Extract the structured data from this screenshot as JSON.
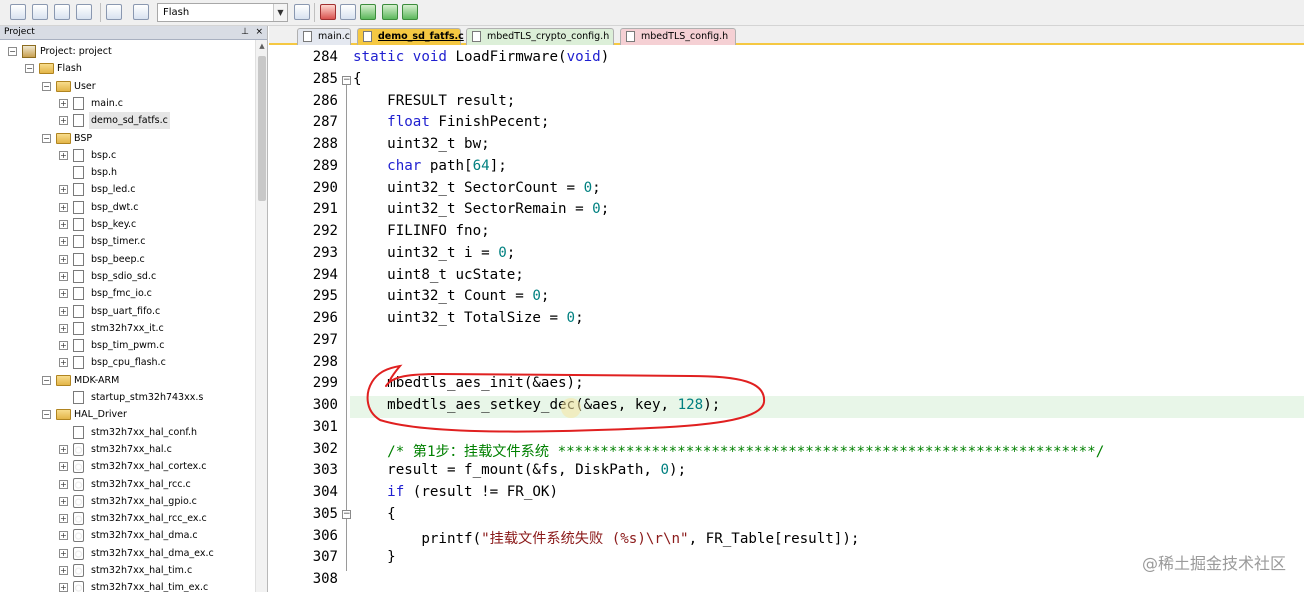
{
  "toolbar": {
    "target": "Flash"
  },
  "project": {
    "title": "Project",
    "pin": "    ",
    "close": "×",
    "root": "Project: project",
    "target": "Flash",
    "groups": [
      {
        "name": "User",
        "files": [
          "main.c",
          "demo_sd_fatfs.c"
        ]
      },
      {
        "name": "BSP",
        "files": [
          "bsp.c",
          "bsp.h",
          "bsp_led.c",
          "bsp_dwt.c",
          "bsp_key.c",
          "bsp_timer.c",
          "bsp_beep.c",
          "bsp_sdio_sd.c",
          "bsp_fmc_io.c",
          "bsp_uart_fifo.c",
          "stm32h7xx_it.c",
          "bsp_tim_pwm.c",
          "bsp_cpu_flash.c"
        ]
      },
      {
        "name": "MDK-ARM",
        "files": [
          "startup_stm32h743xx.s"
        ]
      },
      {
        "name": "HAL_Driver",
        "files": [
          "stm32h7xx_hal_conf.h",
          "stm32h7xx_hal.c",
          "stm32h7xx_hal_cortex.c",
          "stm32h7xx_hal_rcc.c",
          "stm32h7xx_hal_gpio.c",
          "stm32h7xx_hal_rcc_ex.c",
          "stm32h7xx_hal_dma.c",
          "stm32h7xx_hal_dma_ex.c",
          "stm32h7xx_hal_tim.c",
          "stm32h7xx_hal_tim_ex.c"
        ]
      }
    ]
  },
  "tabs": [
    {
      "label": "main.c"
    },
    {
      "label": "demo_sd_fatfs.c"
    },
    {
      "label": "mbedTLS_crypto_config.h"
    },
    {
      "label": "mbedTLS_config.h"
    }
  ],
  "editor": {
    "lines": [
      {
        "no": "284",
        "text": "static void LoadFirmware(void)"
      },
      {
        "no": "285",
        "text": "{"
      },
      {
        "no": "286",
        "text": "    FRESULT result;"
      },
      {
        "no": "287",
        "text": "    float FinishPecent;"
      },
      {
        "no": "288",
        "text": "    uint32_t bw;"
      },
      {
        "no": "289",
        "text": "    char path[64];"
      },
      {
        "no": "290",
        "text": "    uint32_t SectorCount = 0;"
      },
      {
        "no": "291",
        "text": "    uint32_t SectorRemain = 0;"
      },
      {
        "no": "292",
        "text": "    FILINFO fno;"
      },
      {
        "no": "293",
        "text": "    uint32_t i = 0;"
      },
      {
        "no": "294",
        "text": "    uint8_t ucState;"
      },
      {
        "no": "295",
        "text": "    uint32_t Count = 0;"
      },
      {
        "no": "296",
        "text": "    uint32_t TotalSize = 0;"
      },
      {
        "no": "297",
        "text": ""
      },
      {
        "no": "298",
        "text": ""
      },
      {
        "no": "299",
        "text": "    mbedtls_aes_init(&aes);"
      },
      {
        "no": "300",
        "text": "    mbedtls_aes_setkey_dec(&aes, key, 128);"
      },
      {
        "no": "301",
        "text": ""
      },
      {
        "no": "302",
        "text": "    /* 第1步：挂载文件系统 ***************************************************************/"
      },
      {
        "no": "303",
        "text": "    result = f_mount(&fs, DiskPath, 0);"
      },
      {
        "no": "304",
        "text": "    if (result != FR_OK)"
      },
      {
        "no": "305",
        "text": "    {"
      },
      {
        "no": "306",
        "text": "        printf(\"挂载文件系统失败 (%s)\\r\\n\", FR_Table[result]);"
      },
      {
        "no": "307",
        "text": "    }"
      },
      {
        "no": "308",
        "text": ""
      }
    ]
  },
  "watermark": "@稀土掘金技术社区"
}
